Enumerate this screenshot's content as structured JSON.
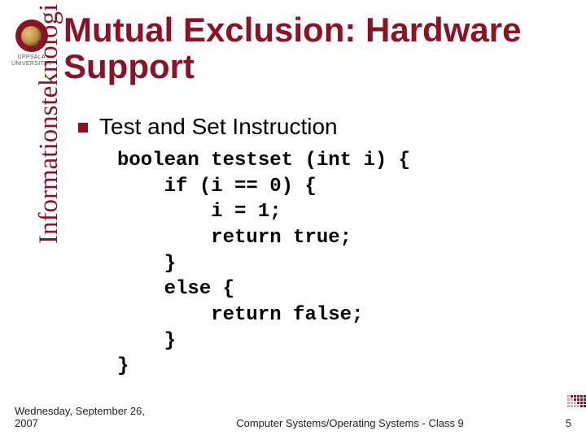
{
  "logo": {
    "line1": "UPPSALA",
    "line2": "UNIVERSITET"
  },
  "title": "Mutual Exclusion: Hardware Support",
  "sidebar_label": "Informationsteknologi",
  "bullet": {
    "text": "Test and Set Instruction"
  },
  "code": "boolean testset (int i) {\n    if (i == 0) {\n        i = 1;\n        return true;\n    }\n    else {\n        return false;\n    }\n}",
  "footer": {
    "date": "Wednesday, September 26, 2007",
    "course": "Computer Systems/Operating Systems - Class 9",
    "page": "5"
  }
}
